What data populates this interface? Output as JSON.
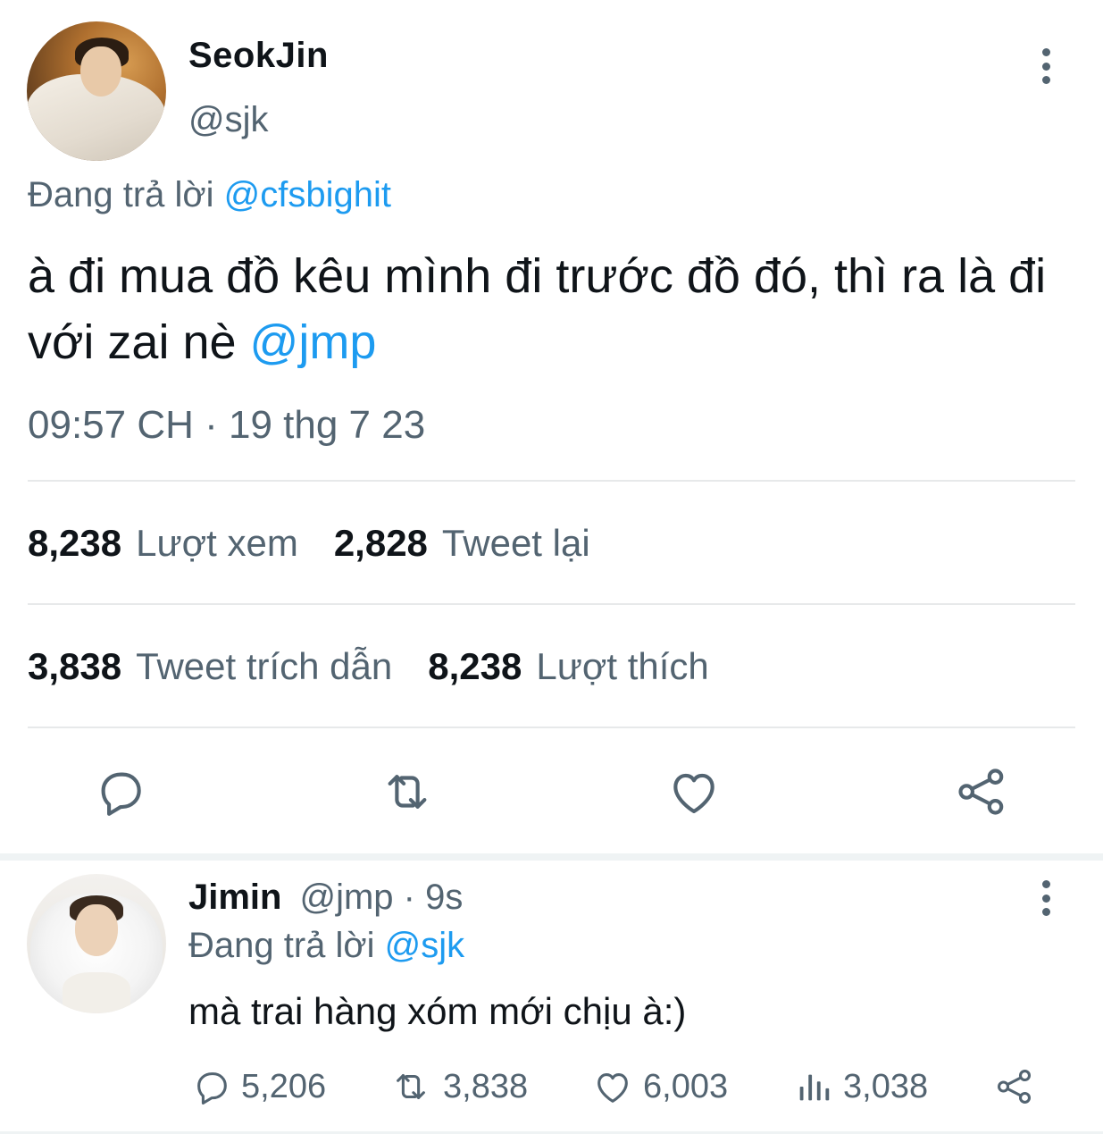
{
  "main_tweet": {
    "display_name": "SeokJin",
    "handle": "@sjk",
    "replying_prefix": "Đang trả lời",
    "replying_to": "@cfsbighit",
    "text": "à đi mua đồ kêu mình đi trước đồ đó, thì ra là đi với zai nè",
    "text_mention": "@jmp",
    "timestamp": "09:57 CH · 19 thg 7 23",
    "stats": {
      "views_count": "8,238",
      "views_label": "Lượt xem",
      "retweets_count": "2,828",
      "retweets_label": "Tweet lại",
      "quotes_count": "3,838",
      "quotes_label": "Tweet trích dẫn",
      "likes_count": "8,238",
      "likes_label": "Lượt thích"
    },
    "actions": [
      "reply-icon",
      "retweet-icon",
      "heart-icon",
      "share-icon"
    ]
  },
  "reply_tweet": {
    "display_name": "Jimin",
    "handle_time": "@jmp · 9s",
    "replying_prefix": "Đang trả lời",
    "replying_to": "@sjk",
    "text": "mà trai hàng xóm mới chịu à:)",
    "reply_count": "5,206",
    "retweet_count": "3,838",
    "like_count": "6,003",
    "views_count": "3,038"
  },
  "colors": {
    "accent": "#1d9bf0",
    "secondary_text": "#536471",
    "primary_text": "#0f1419",
    "divider": "#e7e9ea"
  }
}
